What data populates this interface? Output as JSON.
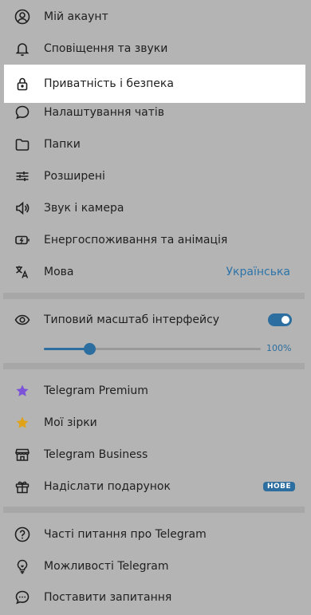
{
  "settings": {
    "items": [
      {
        "label": "Мій акаунт",
        "icon": "user-icon"
      },
      {
        "label": "Сповіщення та звуки",
        "icon": "bell-icon"
      },
      {
        "label": "Приватність і безпека",
        "icon": "lock-icon"
      },
      {
        "label": "Налаштування чатів",
        "icon": "chat-bubble-icon"
      },
      {
        "label": "Папки",
        "icon": "folder-icon"
      },
      {
        "label": "Розширені",
        "icon": "sliders-icon"
      },
      {
        "label": "Звук і камера",
        "icon": "speaker-icon"
      },
      {
        "label": "Енергоспоживання та анімація",
        "icon": "battery-icon"
      },
      {
        "label": "Мова",
        "icon": "translate-icon",
        "value": "Українська"
      }
    ]
  },
  "scale": {
    "label": "Типовий масштаб інтерфейсу",
    "icon": "eye-icon",
    "enabled": true,
    "value_text": "100%",
    "slider_fraction": 0.21
  },
  "premium": {
    "items": [
      {
        "label": "Telegram Premium",
        "icon": "star-purple-icon"
      },
      {
        "label": "Мої зірки",
        "icon": "star-gold-icon"
      },
      {
        "label": "Telegram Business",
        "icon": "shop-icon"
      },
      {
        "label": "Надіслати подарунок",
        "icon": "gift-icon",
        "badge": "НОВЕ"
      }
    ]
  },
  "help": {
    "items": [
      {
        "label": "Часті питання про Telegram",
        "icon": "question-icon"
      },
      {
        "label": "Можливості Telegram",
        "icon": "lightbulb-icon"
      },
      {
        "label": "Поставити запитання",
        "icon": "chat-dots-icon"
      }
    ]
  },
  "colors": {
    "accent": "#2c6e9f",
    "background": "#b4b4b4",
    "highlight": "#ffffff",
    "star_purple": "#7b52d8",
    "star_gold": "#e0a317"
  }
}
